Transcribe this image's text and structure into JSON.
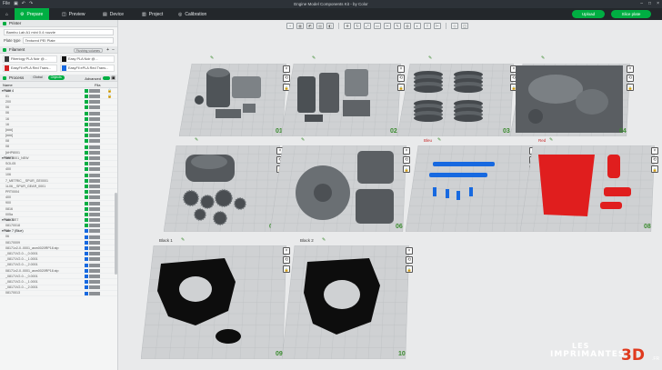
{
  "window": {
    "title": "Engine Model Components Kit - by Color",
    "menu_label": "File"
  },
  "tabs": [
    {
      "label": "Prepare",
      "active": true
    },
    {
      "label": "Preview",
      "active": false
    },
    {
      "label": "Device",
      "active": false
    },
    {
      "label": "Project",
      "active": false
    },
    {
      "label": "Calibration",
      "active": false
    }
  ],
  "top_buttons": {
    "upload": "Upload",
    "slice": "Slice plate"
  },
  "sidebar": {
    "printer_header": "Printer",
    "printer_name": "Bambu Lab A1 mini 0.4 nozzle",
    "plate_type_label": "Plate type",
    "plate_type_value": "Textured PEI Plate",
    "filament_header": "Filament",
    "filament_button": "Flushing volumes",
    "filaments": [
      {
        "label": "Fiberlogy PLA Noir @...",
        "color": "#3a3a3a"
      },
      {
        "label": "Easy PLA Noir @...",
        "color": "#111111"
      },
      {
        "label": "EasyFil ePLA Red Trans...",
        "color": "#d32020"
      },
      {
        "label": "EasyFil ePLA Red Trans...",
        "color": "#1769e0"
      }
    ],
    "process_header": "Process",
    "process_global": "Global",
    "process_objects": "Objects",
    "advanced_label": "Advanced",
    "list_header_name": "Name",
    "list_header_fil": "Fila"
  },
  "object_rows": [
    {
      "name": "Plate 4",
      "plate": true,
      "color": "g",
      "lock": false
    },
    {
      "name": "008",
      "color": "g",
      "lock": true
    },
    {
      "name": "01",
      "color": "g",
      "lock": true
    },
    {
      "name": "200",
      "color": "g",
      "lock": false
    },
    {
      "name": "06",
      "color": "g",
      "lock": false
    },
    {
      "name": "06",
      "color": "g",
      "lock": false
    },
    {
      "name": "16",
      "color": "g",
      "lock": false
    },
    {
      "name": "16",
      "color": "g",
      "lock": false
    },
    {
      "name": "[###]",
      "color": "g",
      "lock": false
    },
    {
      "name": "[###]",
      "color": "g",
      "lock": false
    },
    {
      "name": "08",
      "color": "g",
      "lock": false
    },
    {
      "name": "08",
      "color": "g",
      "lock": false
    },
    {
      "name": "[#HP8001",
      "color": "g",
      "lock": false
    },
    {
      "name": "Plate 5",
      "plate": true,
      "color": "g",
      "lock": false
    },
    {
      "name": "PRT0001_NEW",
      "color": "g",
      "lock": false
    },
    {
      "name": "SOL05",
      "color": "g",
      "lock": false
    },
    {
      "name": "400",
      "color": "g",
      "lock": false
    },
    {
      "name": "106",
      "color": "g",
      "lock": false
    },
    {
      "name": "7_METRIC__SPUR_GE0001",
      "color": "g",
      "lock": false
    },
    {
      "name": "1L06__SPUR_GEAR_0001",
      "color": "g",
      "lock": false
    },
    {
      "name": "PRT0004",
      "color": "g",
      "lock": false
    },
    {
      "name": "400",
      "color": "g",
      "lock": false
    },
    {
      "name": "900",
      "color": "g",
      "lock": false
    },
    {
      "name": "0816",
      "color": "g",
      "lock": false
    },
    {
      "name": "005a",
      "color": "g",
      "lock": false
    },
    {
      "name": "Plate 6",
      "plate": true,
      "color": "g",
      "lock": false
    },
    {
      "name": "08170E7",
      "color": "g",
      "lock": false
    },
    {
      "name": "08170018",
      "color": "g",
      "lock": false
    },
    {
      "name": "Plate 7 (Blue)",
      "plate": true,
      "color": "b",
      "lock": false
    },
    {
      "name": "08",
      "color": "b",
      "lock": false
    },
    {
      "name": "06",
      "color": "b",
      "lock": false
    },
    {
      "name": "08170009",
      "color": "b",
      "lock": false
    },
    {
      "name": "08171v2-0..0001_asm0020RP18.stp",
      "color": "b",
      "lock": false
    },
    {
      "name": "_08171V2-0..._0.0001",
      "color": "b",
      "lock": false
    },
    {
      "name": "_08171V2-0..._1.0001",
      "color": "b",
      "lock": false
    },
    {
      "name": "_08171V2-0..._2.0001",
      "color": "b",
      "lock": false
    },
    {
      "name": "08171v2-0..0001_asm0020RP18.stp",
      "color": "b",
      "lock": false
    },
    {
      "name": "_08171V2-0..._0.0001",
      "color": "b",
      "lock": false
    },
    {
      "name": "_08171V2-0..._1.0001",
      "color": "b",
      "lock": false
    },
    {
      "name": "_08171V2-0..._2.0001",
      "color": "b",
      "lock": false
    },
    {
      "name": "08170013",
      "color": "b",
      "lock": false
    }
  ],
  "plates": [
    {
      "number": "01",
      "name": ""
    },
    {
      "number": "02",
      "name": ""
    },
    {
      "number": "03",
      "name": ""
    },
    {
      "number": "04",
      "name": ""
    },
    {
      "number": "05",
      "name": ""
    },
    {
      "number": "06",
      "name": ""
    },
    {
      "number": "07",
      "name": "Bleu"
    },
    {
      "number": "08",
      "name": "Red"
    },
    {
      "number": "09",
      "name": "Black 1"
    },
    {
      "number": "10",
      "name": "Black 2"
    }
  ],
  "watermark": {
    "line1": "LES",
    "line2": "IMPRIMANTES",
    "line3": "3D",
    "line4": ".FR"
  },
  "colors": {
    "accent": "#00ae42",
    "model_gray": "#555a5e",
    "model_red": "#e01e1e",
    "model_blue": "#1769e0",
    "model_black": "#0d0d0d"
  }
}
